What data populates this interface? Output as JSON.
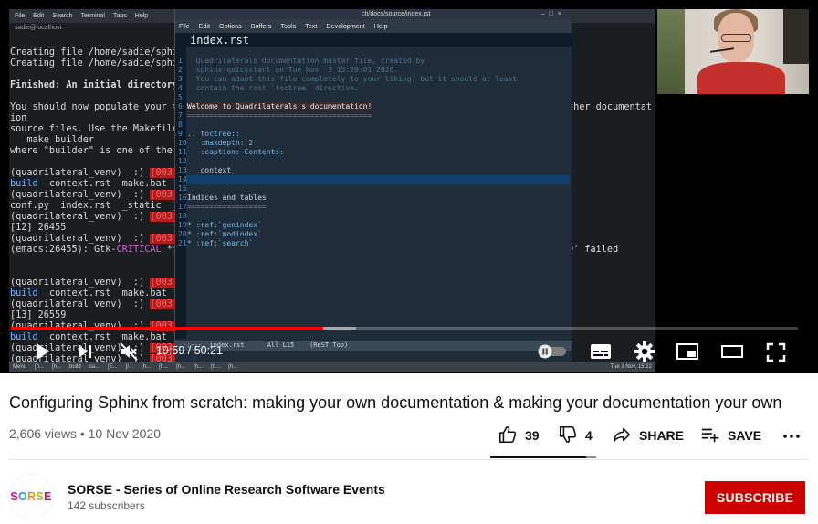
{
  "video": {
    "current_time": "19:59",
    "separator": " / ",
    "duration": "50:21",
    "played_fraction": 0.397,
    "buffered_fraction": 0.438,
    "autoplay_on": false
  },
  "screen": {
    "terminal": {
      "menu": [
        "File",
        "Edit",
        "Search",
        "Terminal",
        "Tabs",
        "Help"
      ],
      "host": "sadie@localhost",
      "lines": [
        "Creating file /home/sadie/sphin",
        "Creating file /home/sadie/sphin",
        "",
        "Finished: An initial directory",
        "",
        "You should now populate your ma",
        "ion",
        "source files. Use the Makefile",
        "   make builder",
        "where \"builder\" is one of the s",
        "",
        "(quadrilateral_venv)  :) [003:2",
        "build  context.rst  make.bat  M",
        "(quadrilateral_venv)  :) [003:2",
        "conf.py  index.rst  _static  _t",
        "(quadrilateral_venv)  :) [003:2",
        "[12] 26455",
        "(quadrilateral_venv)  :) [003:2",
        "(emacs:26455): Gtk-CRITICAL **:",
        "",
        "",
        "(quadrilateral_venv)  :) [003:2",
        "build  context.rst  make.bat  M",
        "(quadrilateral_venv)  :) [003:2",
        "[13] 26559",
        "(quadrilateral_venv)  :) [003:2",
        "build  context.rst  make.bat  M",
        "(quadrilateral_venv)  :) [003:2",
        "(quadrilateral_venv)  :) [003:2"
      ],
      "right_text_1": "ther documentat",
      "right_text_2": "0' failed"
    },
    "emacs": {
      "title": "ch/docs/source/index.rst",
      "menu": [
        "File",
        "Edit",
        "Options",
        "Buffers",
        "Tools",
        "Text",
        "Development",
        "Help"
      ],
      "buffer_name": "index.rst",
      "lines": [
        {
          "n": "1",
          "text": "  Quadrilaterals documentation master file, created by",
          "cls": "c"
        },
        {
          "n": "2",
          "text": "  sphinx-quickstart on Tue Nov  3 15:20:01 2020.",
          "cls": "c"
        },
        {
          "n": "3",
          "text": "  You can adapt this file completely to your liking, but it should at least",
          "cls": "c"
        },
        {
          "n": "4",
          "text": "  contain the root `toctree` directive.",
          "cls": "c"
        },
        {
          "n": "5",
          "text": "",
          "cls": "t"
        },
        {
          "n": "6",
          "text": "Welcome to Quadrilaterals's documentation!",
          "cls": "h"
        },
        {
          "n": "7",
          "text": "==========================================",
          "cls": "u"
        },
        {
          "n": "8",
          "text": "",
          "cls": "t"
        },
        {
          "n": "9",
          "text": ".. toctree::",
          "cls": "k"
        },
        {
          "n": "10",
          "text": "   :maxdepth: 2",
          "cls": "k"
        },
        {
          "n": "11",
          "text": "   :caption: Contents:",
          "cls": "k"
        },
        {
          "n": "12",
          "text": "",
          "cls": "t"
        },
        {
          "n": "13",
          "text": "   context",
          "cls": "t"
        },
        {
          "n": "14",
          "text": "",
          "cls": "t"
        },
        {
          "n": "15",
          "text": "",
          "cls": "t"
        },
        {
          "n": "16",
          "text": "Indices and tables",
          "cls": "t"
        },
        {
          "n": "17",
          "text": "==================",
          "cls": "u"
        },
        {
          "n": "18",
          "text": "",
          "cls": "t"
        },
        {
          "n": "19",
          "text": "* :ref:`genindex`",
          "cls": "k"
        },
        {
          "n": "20",
          "text": "* :ref:`modindex`",
          "cls": "k"
        },
        {
          "n": "21",
          "text": "* :ref:`search`",
          "cls": "k"
        }
      ],
      "modeline": "-:---  index.rst      All L15    (ReST Top)"
    },
    "taskbar_items": [
      "Menu",
      "[h...",
      "[h...",
      "build",
      "sa...",
      "[E...",
      "[/...",
      "[h...",
      "[h...",
      "[h...",
      "[h...",
      "[h...",
      "[h..."
    ],
    "taskbar_clock": "Tue 3 Nov, 15:22"
  },
  "info": {
    "title": "Configuring Sphinx from scratch: making your own documentation & making your documentation your own",
    "views": "2,606 views",
    "dot": " • ",
    "date": "10 Nov 2020",
    "likes": "39",
    "dislikes": "4",
    "share_label": "SHARE",
    "save_label": "SAVE",
    "like_ratio": 0.907
  },
  "channel": {
    "name": "SORSE - Series of Online Research Software Events",
    "subscribers": "142 subscribers",
    "logo_letters": [
      "S",
      "O",
      "R",
      "S",
      "E"
    ],
    "logo_colors": [
      "#e5007d",
      "#1d9bd7",
      "#f39200",
      "#95c11f",
      "#e5007d"
    ],
    "subscribe_label": "SUBSCRIBE"
  },
  "colors": {
    "accent_red": "#ff0000",
    "subscribe_red": "#cc0000"
  }
}
